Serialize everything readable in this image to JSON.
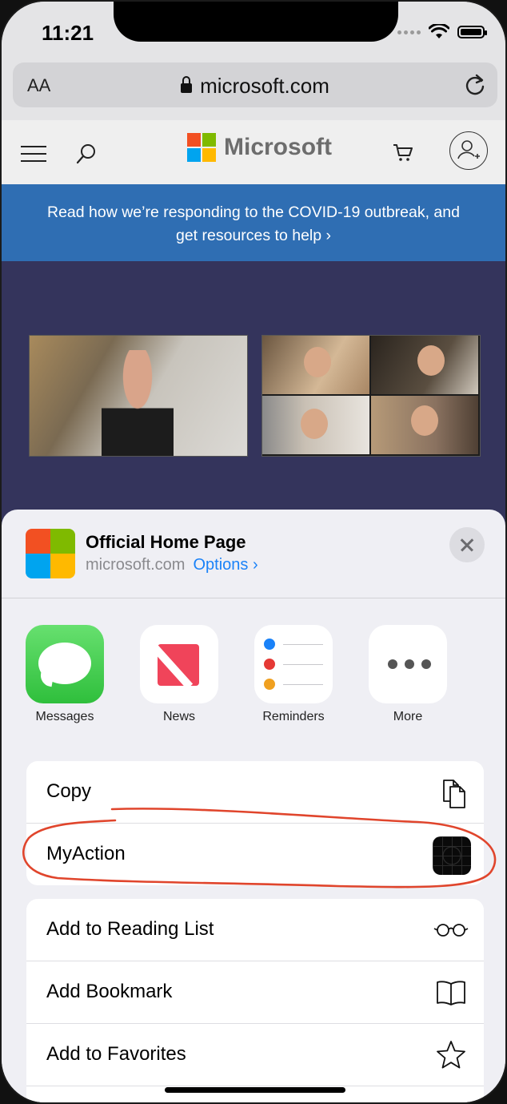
{
  "status_bar": {
    "time": "11:21"
  },
  "address_bar": {
    "text_size_label": "AA",
    "domain": "microsoft.com"
  },
  "site_nav": {
    "brand": "Microsoft"
  },
  "banner": {
    "line1": "Read how we’re responding to the COVID-19 outbreak, and",
    "line2": "get resources to help  ›"
  },
  "share_sheet": {
    "title": "Official Home Page",
    "subtitle": "microsoft.com",
    "options_label": "Options ›",
    "apps": [
      {
        "label": "Messages",
        "icon": "messages-icon"
      },
      {
        "label": "News",
        "icon": "news-icon"
      },
      {
        "label": "Reminders",
        "icon": "reminders-icon"
      },
      {
        "label": "More",
        "icon": "more-icon"
      }
    ],
    "actions_group1": [
      {
        "label": "Copy",
        "icon": "copy-icon"
      },
      {
        "label": "MyAction",
        "icon": "myaction-icon"
      }
    ],
    "actions_group2": [
      {
        "label": "Add to Reading List",
        "icon": "glasses-icon"
      },
      {
        "label": "Add Bookmark",
        "icon": "book-icon"
      },
      {
        "label": "Add to Favorites",
        "icon": "star-icon"
      }
    ]
  },
  "colors": {
    "banner_bg": "#2f6eb3",
    "hero_bg": "#34345c",
    "ios_blue": "#1a82f8",
    "annotation_red": "#e0452c",
    "ms_red": "#f25022",
    "ms_green": "#7fba00",
    "ms_blue": "#00a4ef",
    "ms_yellow": "#ffb900"
  }
}
